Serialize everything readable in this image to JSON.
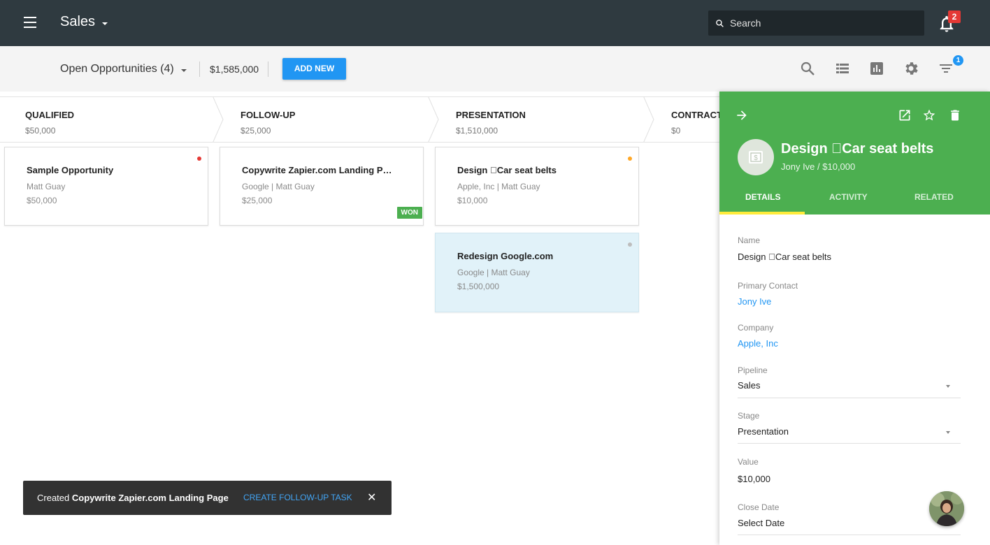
{
  "topbar": {
    "app_title": "Sales",
    "search_placeholder": "Search",
    "notification_count": "2"
  },
  "toolbar": {
    "view_label": "Open Opportunities (4)",
    "total_value": "$1,585,000",
    "add_new_label": "ADD NEW",
    "filter_badge": "1",
    "icons": [
      "search-icon",
      "list-view-icon",
      "report-icon",
      "settings-icon",
      "filter-icon"
    ]
  },
  "stages": [
    {
      "name": "QUALIFIED",
      "value": "$50,000"
    },
    {
      "name": "FOLLOW-UP",
      "value": "$25,000"
    },
    {
      "name": "PRESENTATION",
      "value": "$1,510,000"
    },
    {
      "name": "CONTRACT",
      "value": "$0"
    }
  ],
  "cards": [
    {
      "title": "Sample Opportunity",
      "subtitle": "Matt Guay",
      "value": "$50,000",
      "dot_color": "#e53935"
    },
    {
      "title": "Copywrite Zapier.com Landing P…",
      "subtitle": "Google | Matt Guay",
      "value": "$25,000",
      "badge": "WON"
    },
    {
      "title": "Design Car seat belts",
      "subtitle": "Apple, Inc | Matt Guay",
      "value": "$10,000",
      "dot_color": "#ffa726"
    },
    {
      "title": "Redesign Google.com",
      "subtitle": "Google | Matt Guay",
      "value": "$1,500,000",
      "dot_color": "#bdbdbd"
    }
  ],
  "toast": {
    "prefix": "Created ",
    "bold": "Copywrite Zapier.com Landing Page",
    "action": "CREATE FOLLOW-UP TASK",
    "close": "✕"
  },
  "panel": {
    "title": "Design Car seat belts",
    "subtitle": "Jony Ive / $10,000",
    "tabs": [
      "DETAILS",
      "ACTIVITY",
      "RELATED"
    ],
    "header_color": "#4caf50",
    "fields": {
      "name_label": "Name",
      "name_value": "Design Car seat belts",
      "contact_label": "Primary Contact",
      "contact_value": "Jony Ive",
      "company_label": "Company",
      "company_value": "Apple, Inc",
      "pipeline_label": "Pipeline",
      "pipeline_value": "Sales",
      "stage_label": "Stage",
      "stage_value": "Presentation",
      "value_label": "Value",
      "value_value": "$10,000",
      "close_label": "Close Date",
      "close_value": "Select Date"
    }
  }
}
